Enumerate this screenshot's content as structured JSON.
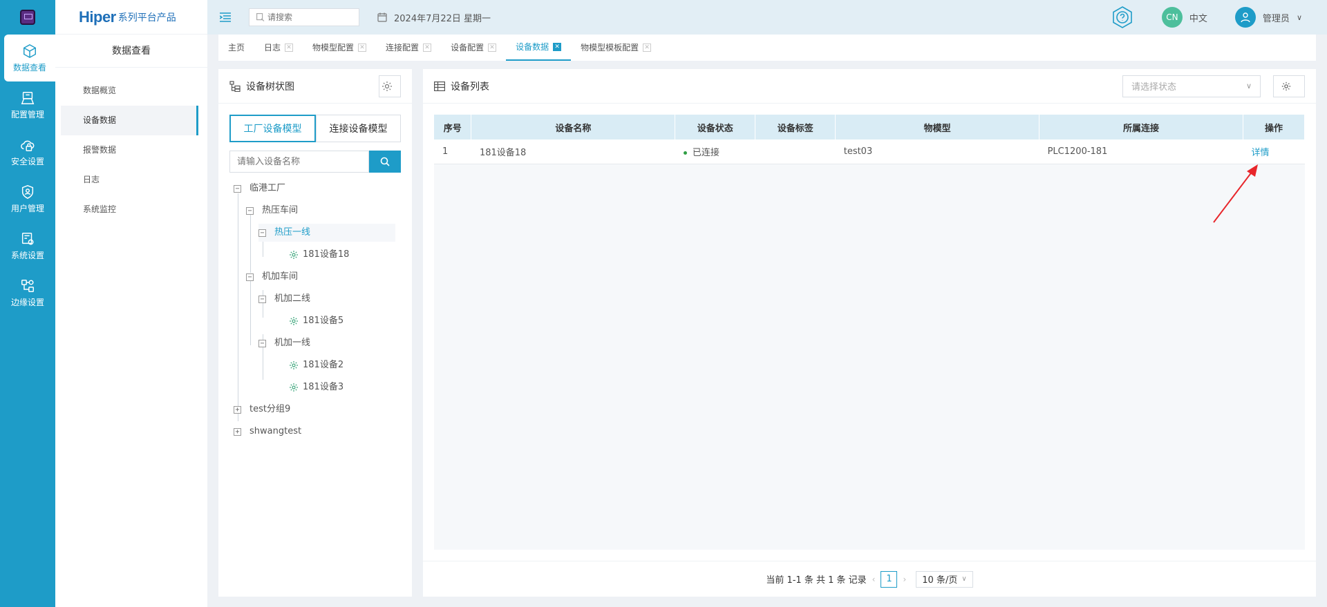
{
  "app": {
    "brand_main": "Hiper",
    "brand_sub": "系列平台产品"
  },
  "rail": {
    "items": [
      {
        "label": "数据查看",
        "icon": "cube-icon",
        "active": true
      },
      {
        "label": "配置管理",
        "icon": "config-icon",
        "active": false
      },
      {
        "label": "安全设置",
        "icon": "cloud-lock-icon",
        "active": false
      },
      {
        "label": "用户管理",
        "icon": "shield-user-icon",
        "active": false
      },
      {
        "label": "系统设置",
        "icon": "system-settings-icon",
        "active": false
      },
      {
        "label": "边缘设置",
        "icon": "edge-nodes-icon",
        "active": false
      }
    ]
  },
  "subnav": {
    "title": "数据查看",
    "items": [
      {
        "label": "数据概览",
        "active": false
      },
      {
        "label": "设备数据",
        "active": true
      },
      {
        "label": "报警数据",
        "active": false
      },
      {
        "label": "日志",
        "active": false
      },
      {
        "label": "系统监控",
        "active": false
      }
    ]
  },
  "header": {
    "search_placeholder": "请搜索",
    "date": "2024年7月22日 星期一",
    "lang_badge": "CN",
    "lang_label": "中文",
    "user_name": "管理员"
  },
  "tabs": [
    {
      "label": "主页",
      "closable": false,
      "active": false
    },
    {
      "label": "日志",
      "closable": true,
      "active": false
    },
    {
      "label": "物模型配置",
      "closable": true,
      "active": false
    },
    {
      "label": "连接配置",
      "closable": true,
      "active": false
    },
    {
      "label": "设备配置",
      "closable": true,
      "active": false
    },
    {
      "label": "设备数据",
      "closable": true,
      "active": true
    },
    {
      "label": "物模型模板配置",
      "closable": true,
      "active": false
    }
  ],
  "tree_panel": {
    "title": "设备树状图",
    "model_tabs": [
      {
        "label": "工厂设备模型",
        "active": true
      },
      {
        "label": "连接设备模型",
        "active": false
      }
    ],
    "search_placeholder": "请输入设备名称",
    "nodes": [
      {
        "label": "临港工厂",
        "toggle": "−",
        "level": 0
      },
      {
        "label": "热压车间",
        "toggle": "−",
        "level": 1
      },
      {
        "label": "热压一线",
        "toggle": "−",
        "level": 2,
        "selected": true
      },
      {
        "label": "181设备18",
        "toggle": "",
        "level": 3
      },
      {
        "label": "机加车间",
        "toggle": "−",
        "level": 1
      },
      {
        "label": "机加二线",
        "toggle": "−",
        "level": 2
      },
      {
        "label": "181设备5",
        "toggle": "",
        "level": 3
      },
      {
        "label": "机加一线",
        "toggle": "−",
        "level": 2
      },
      {
        "label": "181设备2",
        "toggle": "",
        "level": 3
      },
      {
        "label": "181设备3",
        "toggle": "",
        "level": 3
      },
      {
        "label": "test分组9",
        "toggle": "+",
        "level": 0
      },
      {
        "label": "shwangtest",
        "toggle": "+",
        "level": 0
      }
    ]
  },
  "list_panel": {
    "title": "设备列表",
    "status_placeholder": "请选择状态",
    "columns": [
      "序号",
      "设备名称",
      "设备状态",
      "设备标签",
      "物模型",
      "所属连接",
      "操作"
    ],
    "rows": [
      {
        "index": "1",
        "name": "181设备18",
        "status": "已连接",
        "tag": "",
        "model": "test03",
        "connection": "PLC1200-181",
        "action": "详情"
      }
    ],
    "status_color": "#2f9e44"
  },
  "pager": {
    "summary": "当前 1-1 条 共 1 条 记录",
    "page": "1",
    "page_size": "10 条/页"
  },
  "colors": {
    "accent": "#1e9cc8",
    "rail_bg": "#1e9cc8",
    "annotation_arrow": "#e8262b"
  }
}
